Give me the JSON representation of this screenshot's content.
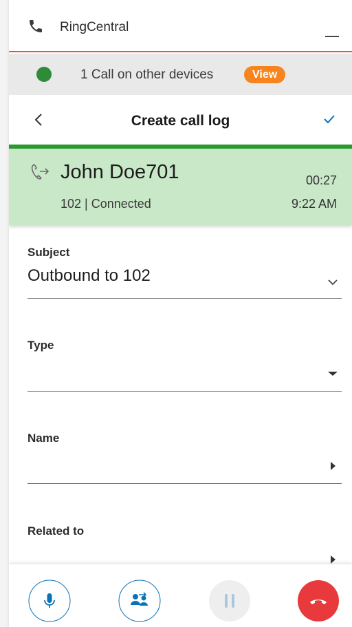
{
  "titlebar": {
    "app_name": "RingCentral",
    "phone_icon": "phone-icon",
    "minimize_icon": "minimize-icon"
  },
  "banner": {
    "text": "1 Call on other devices",
    "view_label": "View",
    "status_color": "#2e8b3a",
    "view_color": "#f6851f"
  },
  "header": {
    "title": "Create call log",
    "back_icon": "chevron-left-icon",
    "save_icon": "check-icon"
  },
  "call": {
    "contact_name": "John Doe701",
    "duration": "00:27",
    "status": "102 | Connected",
    "time": "9:22 AM",
    "direction_icon": "outbound-call-icon",
    "card_color": "#c8e8c7"
  },
  "form": {
    "subject": {
      "label": "Subject",
      "value": "Outbound to 102",
      "control_icon": "chevron-down-icon"
    },
    "type": {
      "label": "Type",
      "value": "",
      "control_icon": "caret-down-icon"
    },
    "name": {
      "label": "Name",
      "value": "",
      "control_icon": "caret-right-icon"
    },
    "related": {
      "label": "Related to",
      "value": "",
      "control_icon": "caret-right-icon"
    }
  },
  "controls": {
    "mute_icon": "microphone-icon",
    "transfer_icon": "transfer-icon",
    "hold_icon": "pause-icon",
    "hangup_icon": "hang-up-icon",
    "hangup_color": "#e8393d",
    "accent_color": "#0a73b8"
  }
}
